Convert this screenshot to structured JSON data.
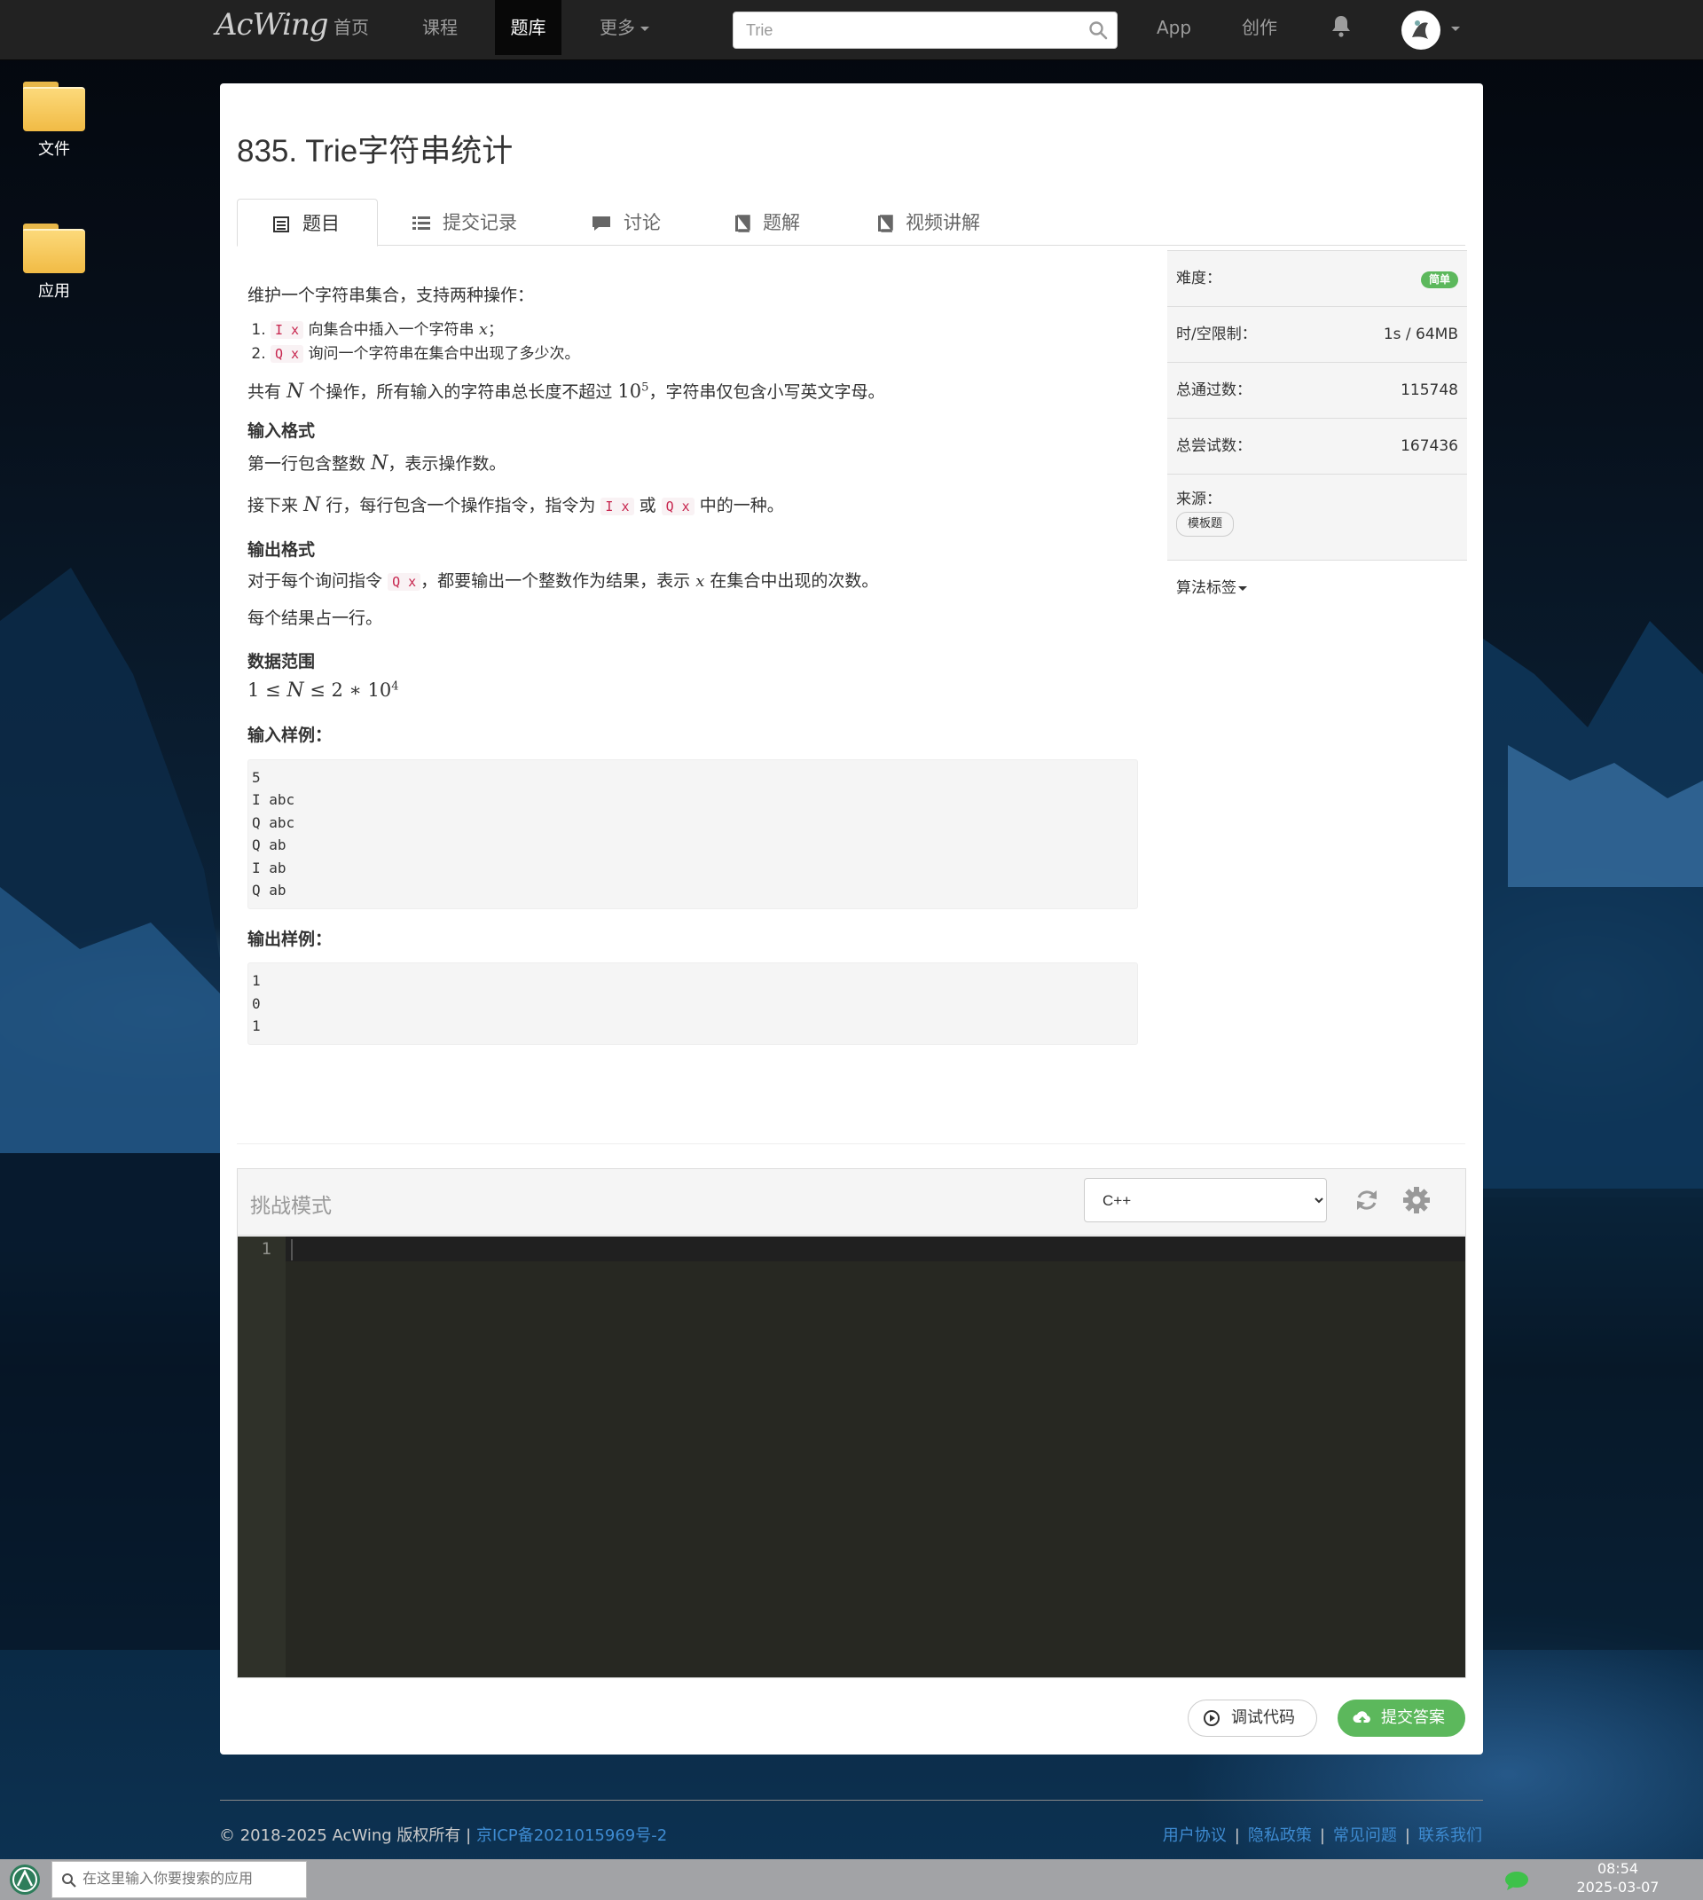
{
  "navbar": {
    "logo": "AcWing",
    "items": [
      {
        "label": "首页"
      },
      {
        "label": "课程"
      },
      {
        "label": "题库",
        "active": true
      },
      {
        "label": "更多"
      }
    ],
    "search_value": "Trie",
    "right_items": [
      {
        "label": "App"
      },
      {
        "label": "创作"
      }
    ]
  },
  "desktop": {
    "icons": [
      {
        "label": "文件"
      },
      {
        "label": "应用"
      }
    ]
  },
  "problem": {
    "title": "835. Trie字符串统计",
    "tabs": [
      {
        "label": "题目",
        "icon": "list-alt-icon"
      },
      {
        "label": "提交记录",
        "icon": "list-icon"
      },
      {
        "label": "讨论",
        "icon": "comment-icon"
      },
      {
        "label": "题解",
        "icon": "book-icon"
      },
      {
        "label": "视频讲解",
        "icon": "book-icon"
      }
    ],
    "intro": "维护一个字符串集合，支持两种操作：",
    "ops": [
      {
        "code": "I x",
        "text": "向集合中插入一个字符串",
        "var": "x",
        "end": "；"
      },
      {
        "code": "Q x",
        "text": "询问一个字符串在集合中出现了多少次。"
      }
    ],
    "p1": {
      "a": "共有",
      "var": "N",
      "b": "个操作，所有输入的字符串总长度不超过",
      "num": "10",
      "exp": "5",
      "c": "，字符串仅包含小写英文字母。"
    },
    "input_fmt_title": "输入格式",
    "input_p1": {
      "a": "第一行包含整数",
      "var": "N",
      "b": "，表示操作数。"
    },
    "input_p2": {
      "a": "接下来",
      "var": "N",
      "b": "行，每行包含一个操作指令，指令为",
      "code1": "I x",
      "c": "或",
      "code2": "Q x",
      "d": "中的一种。"
    },
    "output_fmt_title": "输出格式",
    "output_p1": {
      "a": "对于每个询问指令",
      "code": "Q x",
      "b": "，都要输出一个整数作为结果，表示",
      "var": "x",
      "c": "在集合中出现的次数。"
    },
    "output_p2": "每个结果占一行。",
    "range_title": "数据范围",
    "range": {
      "a": "1 ≤ ",
      "var": "N",
      "b": " ≤ 2 ∗ 10",
      "exp": "4"
    },
    "sample_in_title": "输入样例：",
    "sample_in": "5\nI abc\nQ abc\nQ ab\nI ab\nQ ab",
    "sample_out_title": "输出样例：",
    "sample_out": "1\n0\n1"
  },
  "sidebar": {
    "difficulty_label": "难度：",
    "difficulty": "简单",
    "limit_label": "时/空限制：",
    "limit": "1s / 64MB",
    "passed_label": "总通过数：",
    "passed": "115748",
    "tried_label": "总尝试数：",
    "tried": "167436",
    "source_label": "来源：",
    "source": "模板题",
    "tags_label": "算法标签"
  },
  "editor": {
    "mode": "挑战模式",
    "language": "C++",
    "language_options": [
      "C++"
    ],
    "line_number": "1"
  },
  "buttons": {
    "debug": "调试代码",
    "submit": "提交答案"
  },
  "footer": {
    "copyright": "© 2018-2025 AcWing 版权所有",
    "sep": "|",
    "icp": "京ICP备2021015969号-2",
    "links": [
      "用户协议",
      "隐私政策",
      "常见问题",
      "联系我们"
    ]
  },
  "taskbar": {
    "search_placeholder": "在这里输入你要搜索的应用",
    "time": "08:54",
    "date": "2025-03-07"
  },
  "colors": {
    "navbar": "#222222",
    "success": "#5cb85c",
    "link": "#3e8bd1",
    "code": "#c7254e",
    "editor_bg": "#272822"
  }
}
